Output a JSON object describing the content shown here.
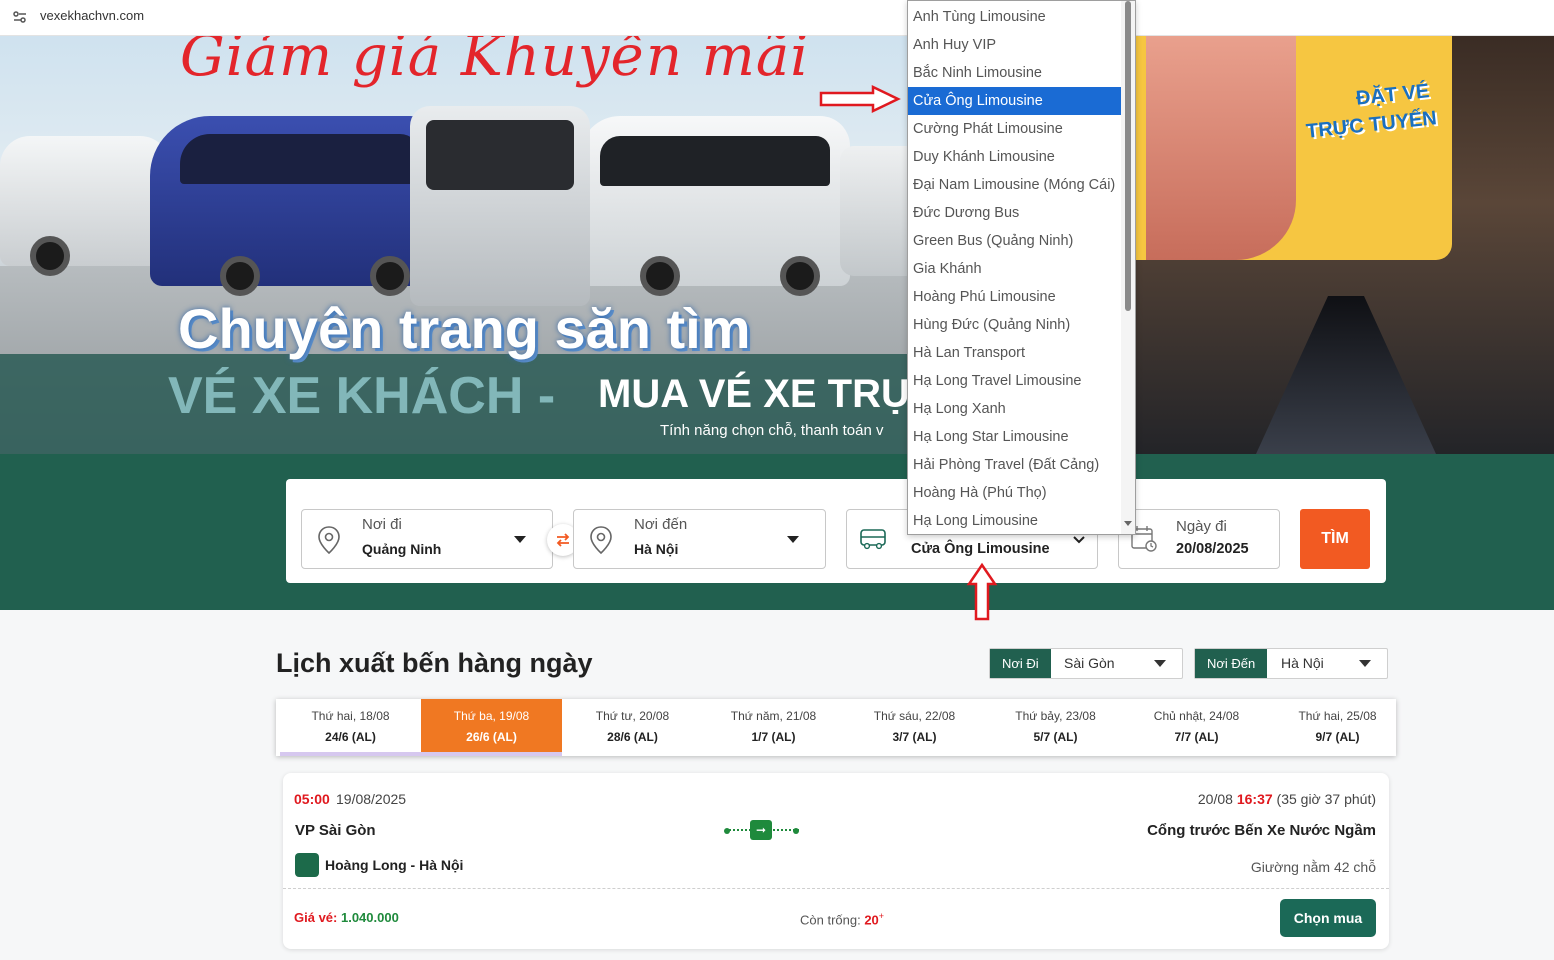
{
  "browser": {
    "url": "vexekhachvn.com"
  },
  "hero": {
    "promo_script": "Giảm giá      Khuyến mãi",
    "title_line1": "Chuyên trang săn tìm",
    "title_line2a": "VÉ XE KHÁCH - ",
    "title_line2b": "MUA VÉ XE TRỰ",
    "subtitle": "Tính năng chọn chỗ, thanh toán v",
    "promo_badge_line1": "ĐẶT VÉ",
    "promo_badge_line2": "TRỰC TUYẾN"
  },
  "search": {
    "from_label": "Nơi đi",
    "from_value": "Quảng Ninh",
    "to_label": "Nơi đến",
    "to_value": "Hà Nội",
    "operator_value": "Cửa Ông Limousine",
    "date_label": "Ngày đi",
    "date_value": "20/08/2025",
    "search_button": "TÌM"
  },
  "operator_dropdown": {
    "options": [
      "Anh Tùng Limousine",
      "Anh Huy VIP",
      "Bắc Ninh Limousine",
      "Cửa Ông Limousine",
      "Cường Phát Limousine",
      "Duy Khánh Limousine",
      "Đại Nam Limousine (Móng Cái)",
      "Đức Dương Bus",
      "Green Bus (Quảng Ninh)",
      "Gia Khánh",
      "Hoàng Phú Limousine",
      "Hùng Đức (Quảng Ninh)",
      "Hà Lan Transport",
      "Hạ Long Travel Limousine",
      "Hạ Long Xanh",
      "Hạ Long Star Limousine",
      "Hải Phòng Travel (Đất Cảng)",
      "Hoàng Hà (Phú Thọ)",
      "Hạ Long Limousine"
    ],
    "selected": "Cửa Ông Limousine"
  },
  "schedule": {
    "title": "Lịch xuất bến hàng ngày",
    "from_tag": "Nơi Đi",
    "from_value": "Sài Gòn",
    "to_tag": "Nơi Đến",
    "to_value": "Hà Nội",
    "days": [
      {
        "day": "Thứ hai, 18/08",
        "lunar": "24/6 (AL)"
      },
      {
        "day": "Thứ ba, 19/08",
        "lunar": "26/6 (AL)"
      },
      {
        "day": "Thứ tư, 20/08",
        "lunar": "28/6 (AL)"
      },
      {
        "day": "Thứ năm, 21/08",
        "lunar": "1/7 (AL)"
      },
      {
        "day": "Thứ sáu, 22/08",
        "lunar": "3/7 (AL)"
      },
      {
        "day": "Thứ bảy, 23/08",
        "lunar": "5/7 (AL)"
      },
      {
        "day": "Chủ nhật, 24/08",
        "lunar": "7/7 (AL)"
      },
      {
        "day": "Thứ hai, 25/08",
        "lunar": "9/7 (AL)"
      }
    ],
    "active_day": "Thứ ba, 19/08"
  },
  "trip": {
    "depart_time": "05:00",
    "depart_date": "19/08/2025",
    "arrive_date": "20/08",
    "arrive_time": "16:37",
    "duration": "(35 giờ 37 phút)",
    "origin": "VP Sài Gòn",
    "destination": "Cổng trước Bến Xe Nước Ngầm",
    "operator": "Hoàng Long - Hà Nội",
    "vehicle": "Giường nằm 42 chỗ",
    "price_label": "Giá vé:",
    "price": "1.040.000",
    "seats_label": "Còn trống:",
    "seats": "20",
    "seats_suffix": "+",
    "buy_button": "Chọn mua"
  },
  "colors": {
    "brand_green": "#21604f",
    "search_orange": "#f25a22",
    "active_tab_orange": "#f07822",
    "selected_option_blue": "#1a6bd4",
    "annotation_red": "#e0191f"
  }
}
